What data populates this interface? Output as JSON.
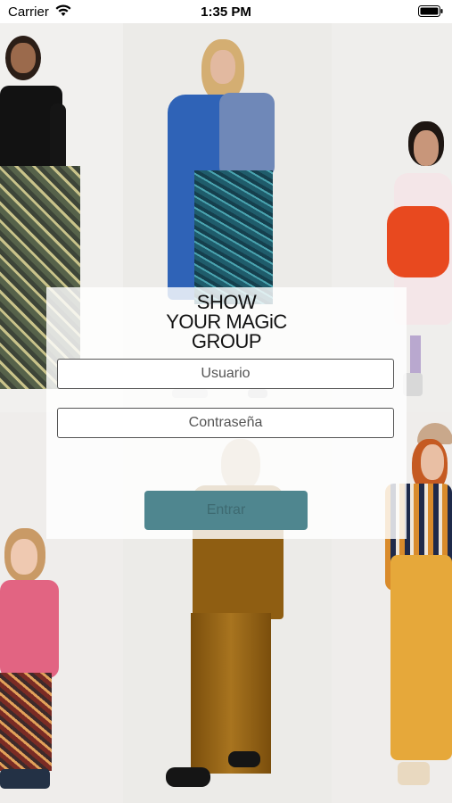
{
  "status_bar": {
    "carrier": "Carrier",
    "time": "1:35 PM",
    "wifi_icon": "wifi-icon",
    "battery_icon": "battery-icon"
  },
  "logo": {
    "line1": "SHOW",
    "line2": "YOUR MAGiC",
    "line3": "GROUP"
  },
  "login": {
    "username_placeholder": "Usuario",
    "password_placeholder": "Contraseña",
    "submit_label": "Entrar"
  },
  "colors": {
    "button": "#4f868f",
    "button_text": "#3e6a71"
  },
  "photos": [
    "model-black-top-patterned-pants",
    "model-blue-scarf-floral-pants",
    "child-strawberry-dress",
    "child-pink-sweater",
    "model-velvet-suit",
    "model-striped-shirt-yellow-pants"
  ]
}
